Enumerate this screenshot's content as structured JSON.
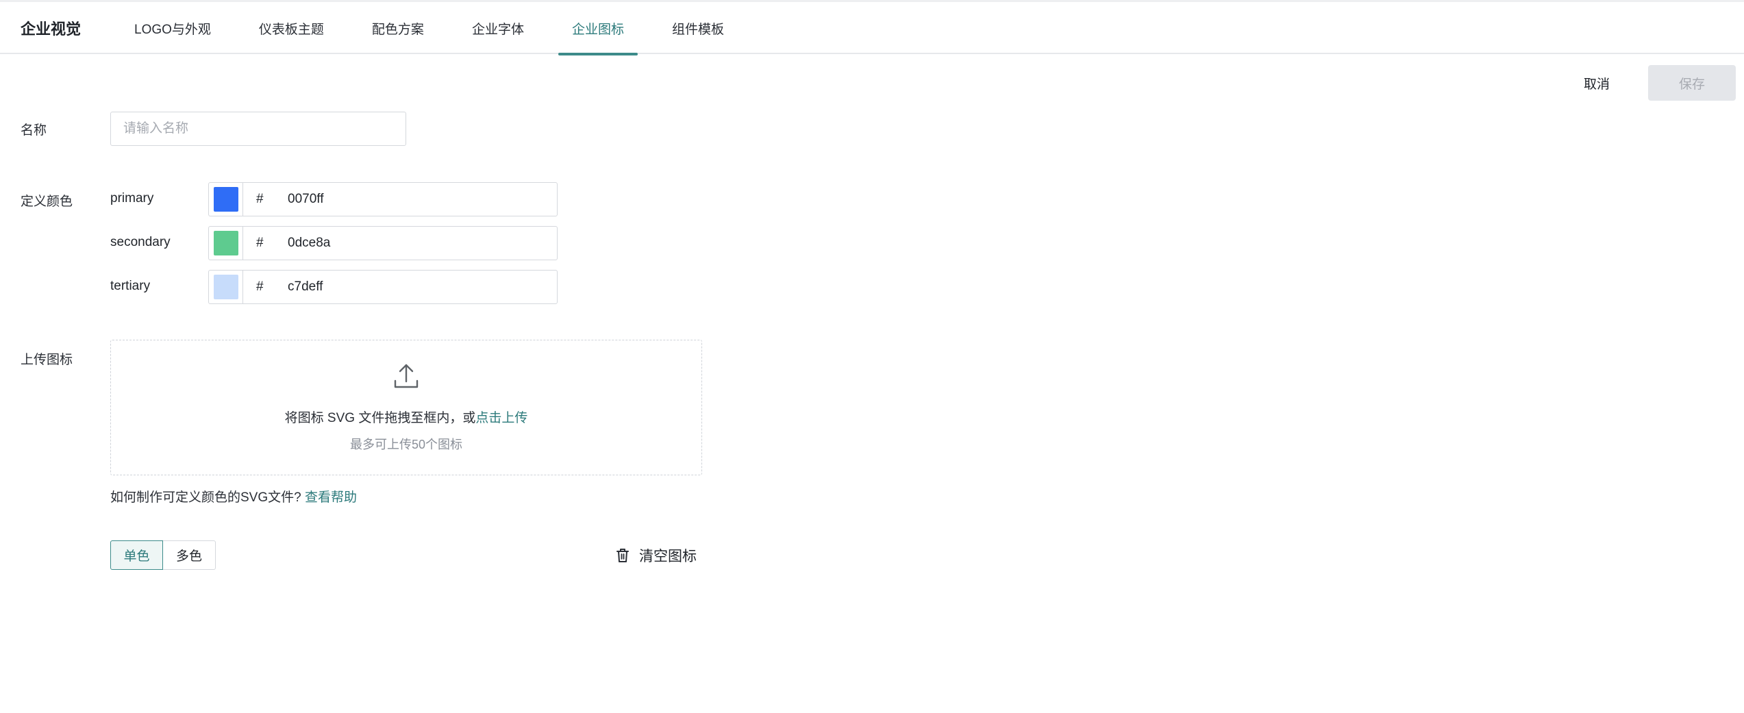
{
  "header": {
    "brand": "企业视觉",
    "tabs": [
      {
        "label": "LOGO与外观",
        "active": false
      },
      {
        "label": "仪表板主题",
        "active": false
      },
      {
        "label": "配色方案",
        "active": false
      },
      {
        "label": "企业字体",
        "active": false
      },
      {
        "label": "企业图标",
        "active": true
      },
      {
        "label": "组件模板",
        "active": false
      }
    ]
  },
  "actions": {
    "cancel_label": "取消",
    "save_label": "保存"
  },
  "form": {
    "name_label": "名称",
    "name_placeholder": "请输入名称",
    "name_value": "",
    "color_label": "定义颜色",
    "colors": [
      {
        "name": "primary",
        "hash": "#",
        "hex": "0070ff",
        "swatch": "#2f6df6"
      },
      {
        "name": "secondary",
        "hash": "#",
        "hex": "0dce8a",
        "swatch": "#5ecb8f"
      },
      {
        "name": "tertiary",
        "hash": "#",
        "hex": "c7deff",
        "swatch": "#c7dcfb"
      }
    ],
    "upload_label": "上传图标",
    "upload": {
      "text_prefix": "将图标 SVG 文件拖拽至框内，或",
      "text_link": "点击上传",
      "hint": "最多可上传50个图标",
      "icon": "upload-icon"
    },
    "help": {
      "text": "如何制作可定义颜色的SVG文件?",
      "link": "查看帮助"
    },
    "mode": {
      "options": [
        "单色",
        "多色"
      ],
      "selected": "单色"
    },
    "clear_label": "清空图标",
    "clear_icon": "trash-icon"
  },
  "colors": {
    "accent": "#2c7a7b",
    "accent_underline": "#3d8b8a"
  }
}
